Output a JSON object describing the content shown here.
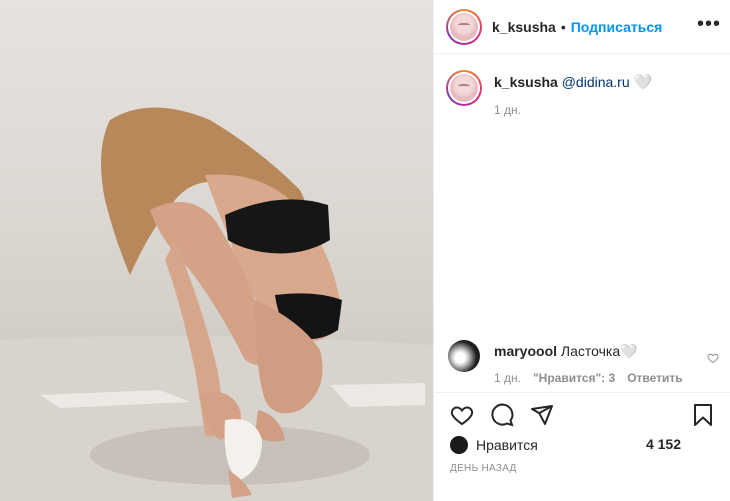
{
  "header": {
    "username": "k_ksusha",
    "separator": "•",
    "follow_label": "Подписаться",
    "more_icon": "more-horizontal-icon"
  },
  "caption": {
    "username": "k_ksusha",
    "mention": "@didina.ru",
    "emoji": "🤍",
    "time": "1 дн."
  },
  "comment": {
    "username": "maryoool",
    "text": "Ласточка🤍",
    "time": "1 дн.",
    "likes": "\"Нравится\": 3",
    "reply": "Ответить",
    "like_icon": "heart-outline-small-icon"
  },
  "actions": {
    "like_icon": "heart-icon",
    "comment_icon": "comment-icon",
    "share_icon": "send-icon",
    "save_icon": "bookmark-icon"
  },
  "likes": {
    "label": "Нравится",
    "count": "4 152"
  },
  "posted": "ДЕНЬ НАЗАД",
  "colors": {
    "accent": "#0095f6",
    "mention": "#00376b",
    "muted": "#8e8e8e",
    "text": "#262626"
  }
}
